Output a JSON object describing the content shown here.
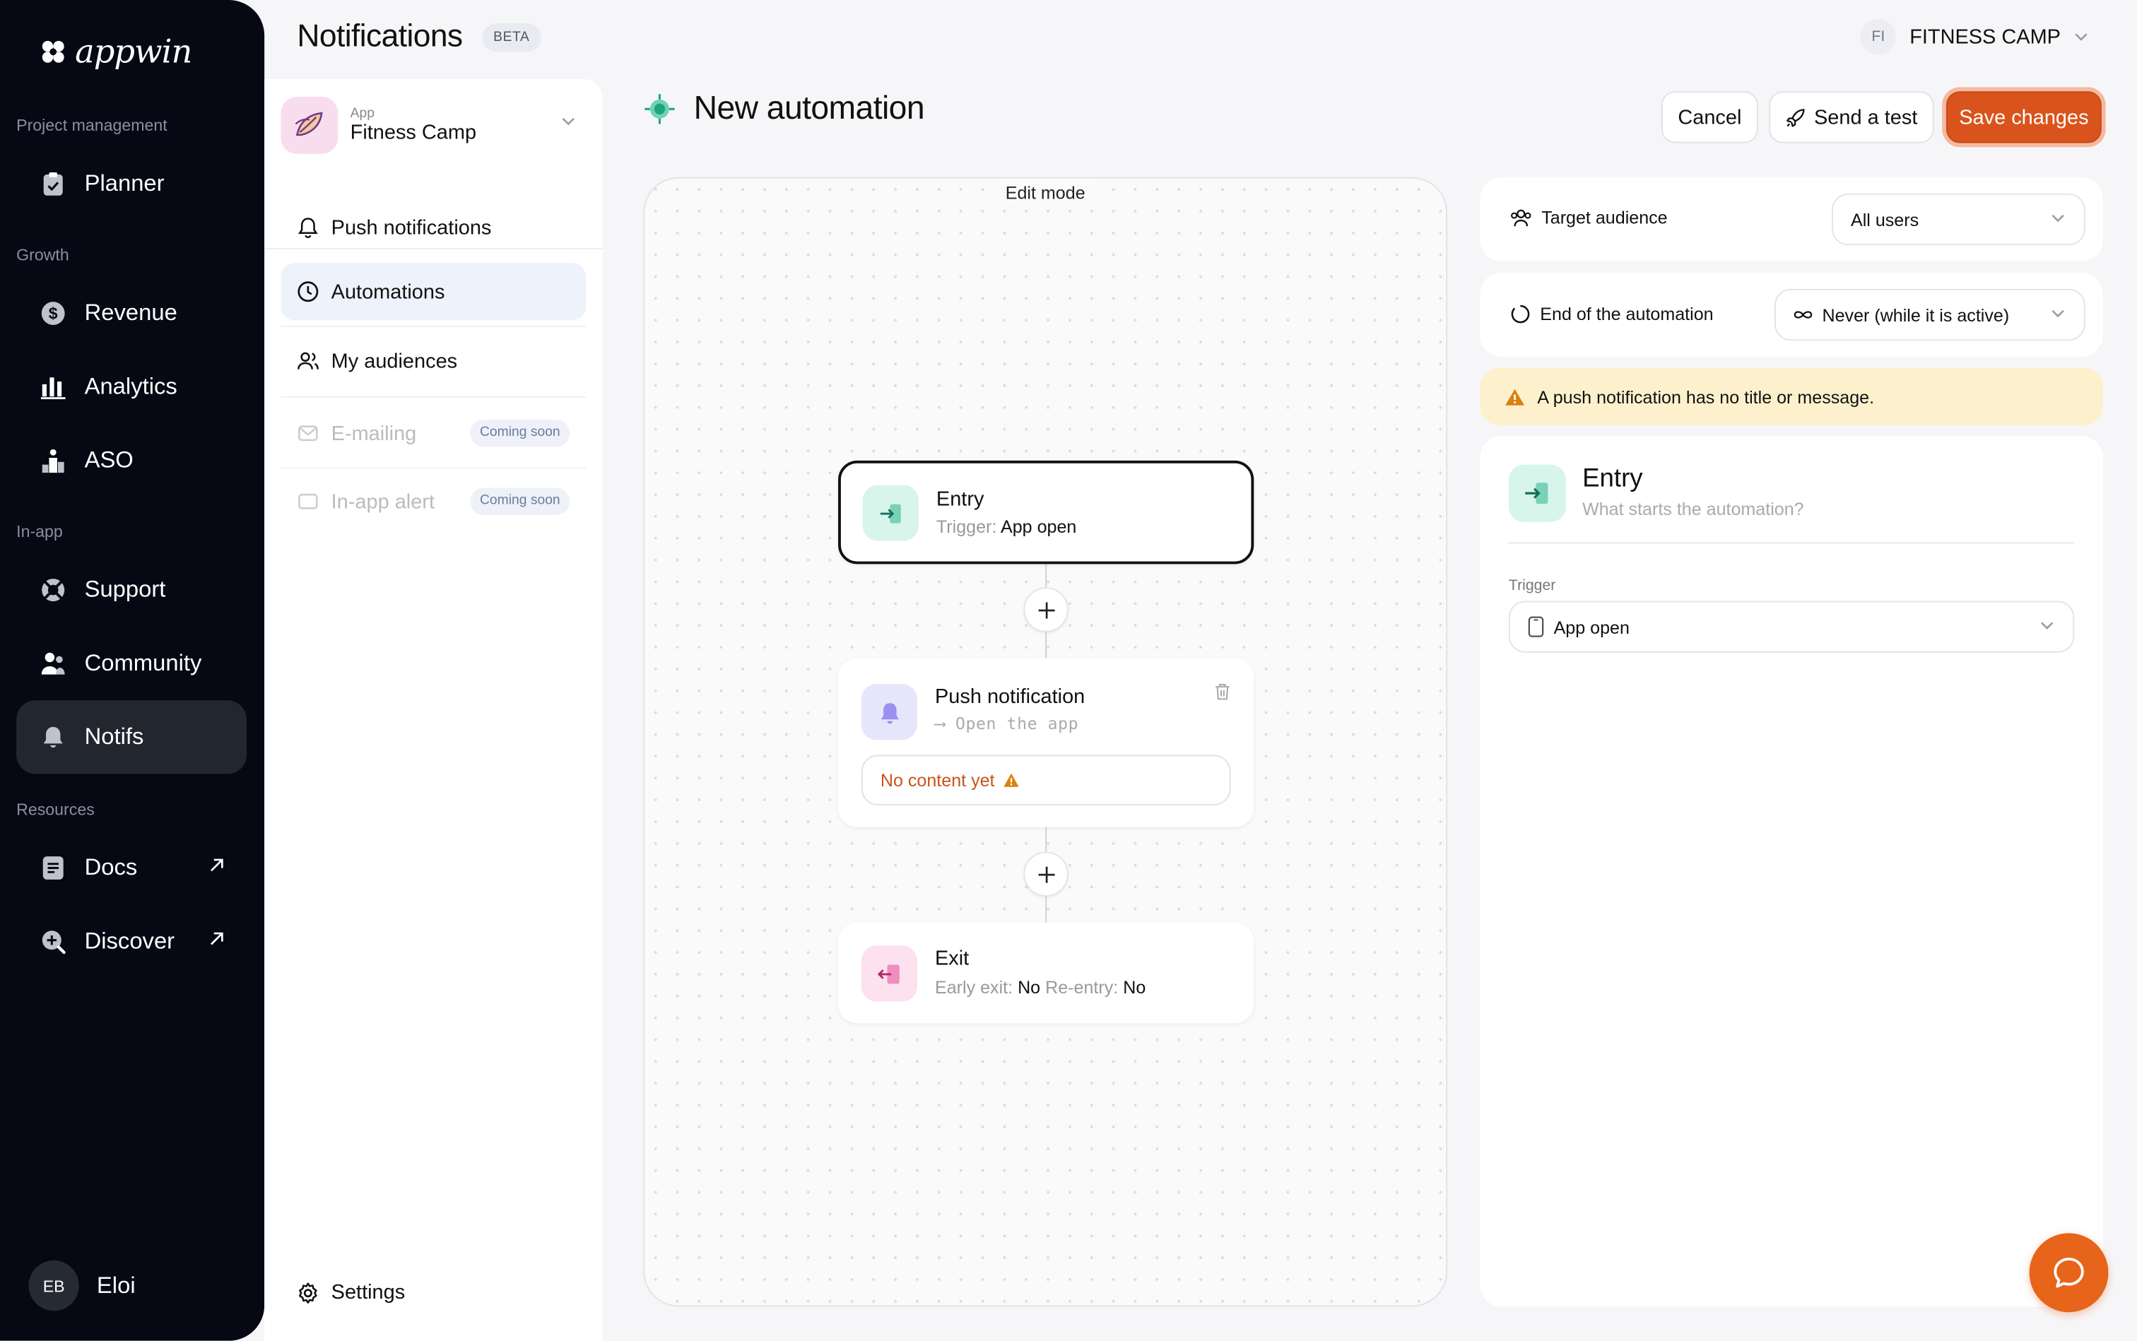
{
  "brand": {
    "name": "appwin"
  },
  "sidebar": {
    "sections": [
      {
        "label": "Project management"
      },
      {
        "label": "Growth"
      },
      {
        "label": "In-app"
      },
      {
        "label": "Resources"
      }
    ],
    "items": [
      {
        "label": "Planner",
        "icon": "clipboard-icon"
      },
      {
        "label": "Revenue",
        "icon": "dollar-icon"
      },
      {
        "label": "Analytics",
        "icon": "bar-chart-icon"
      },
      {
        "label": "ASO",
        "icon": "podium-icon"
      },
      {
        "label": "Support",
        "icon": "lifebuoy-icon"
      },
      {
        "label": "Community",
        "icon": "people-icon"
      },
      {
        "label": "Notifs",
        "icon": "bell-icon",
        "active": true
      },
      {
        "label": "Docs",
        "icon": "document-icon",
        "external": true
      },
      {
        "label": "Discover",
        "icon": "discover-search-icon",
        "external": true
      }
    ],
    "user": {
      "initials": "EB",
      "name": "Eloi"
    }
  },
  "header": {
    "title": "Notifications",
    "badge": "BETA",
    "workspace": {
      "initials": "FI",
      "name": "FITNESS CAMP"
    }
  },
  "subnav": {
    "app": {
      "small_label": "App",
      "name": "Fitness Camp"
    },
    "items": [
      {
        "label": "Push notifications",
        "icon": "bell-outline-icon"
      },
      {
        "label": "Automations",
        "icon": "clock-icon",
        "active": true
      },
      {
        "label": "My audiences",
        "icon": "audience-icon"
      },
      {
        "label": "E-mailing",
        "icon": "mail-icon",
        "disabled": true,
        "badge": "Coming soon"
      },
      {
        "label": "In-app alert",
        "icon": "phone-icon",
        "disabled": true,
        "badge": "Coming soon"
      }
    ],
    "settings_label": "Settings"
  },
  "automation": {
    "title": "New automation",
    "cancel_label": "Cancel",
    "send_test_label": "Send a test",
    "save_label": "Save changes"
  },
  "canvas": {
    "mode_label": "Edit mode",
    "entry": {
      "title": "Entry",
      "trigger_label": "Trigger:",
      "trigger_value": "App open"
    },
    "push": {
      "title": "Push notification",
      "action": "⟶ Open the app",
      "warning": "No content yet"
    },
    "exit": {
      "title": "Exit",
      "early_label": "Early exit:",
      "early_value": "No",
      "reentry_label": "Re-entry:",
      "reentry_value": "No"
    }
  },
  "panel": {
    "target_label": "Target audience",
    "target_value": "All users",
    "end_label": "End of the automation",
    "end_value": "Never (while it is active)",
    "warning": "A push notification has no title or message.",
    "detail": {
      "title": "Entry",
      "subtitle": "What starts the automation?",
      "trigger_label": "Trigger",
      "trigger_value": "App open"
    }
  },
  "colors": {
    "accent": "#d9541c",
    "sidebar_bg": "#060814",
    "entry_icon_bg": "#d8f5ec",
    "push_icon_bg": "#e6e6fb",
    "exit_icon_bg": "#fde1ee",
    "warning_bg": "#fdf1cd"
  }
}
